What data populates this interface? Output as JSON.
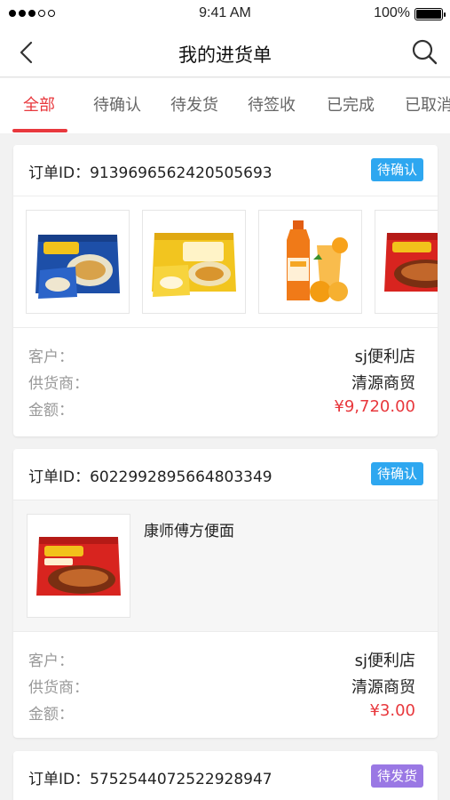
{
  "status_bar": {
    "time": "9:41 AM",
    "battery": "100%"
  },
  "nav": {
    "title": "我的进货单",
    "back_icon": "back-chevron-icon",
    "search_icon": "search-icon"
  },
  "tabs": [
    {
      "label": "全部",
      "active": true
    },
    {
      "label": "待确认",
      "active": false
    },
    {
      "label": "待发货",
      "active": false
    },
    {
      "label": "待签收",
      "active": false
    },
    {
      "label": "已完成",
      "active": false
    },
    {
      "label": "已取消",
      "active": false
    }
  ],
  "labels": {
    "customer": "客户：",
    "supplier": "供货商：",
    "amount": "金额："
  },
  "colors": {
    "accent": "#e8383d",
    "badge_pending_confirm": "#2ea7f0",
    "badge_pending_ship": "#9a78e4"
  },
  "orders": [
    {
      "id_text": "订单ID：9139696562420505693",
      "status": "待确认",
      "products": [
        "noodle-pack-blue",
        "noodle-pack-yellow",
        "orange-juice-bottle",
        "noodle-pack-red"
      ],
      "customer": "sj便利店",
      "supplier": "清源商贸",
      "amount": "¥9,720.00"
    },
    {
      "id_text": "订单ID：6022992895664803349",
      "status": "待确认",
      "product_name": "康师傅方便面",
      "customer": "sj便利店",
      "supplier": "清源商贸",
      "amount": "¥3.00"
    },
    {
      "id_text": "订单ID：5752544072522928947",
      "status": "待发货"
    }
  ]
}
